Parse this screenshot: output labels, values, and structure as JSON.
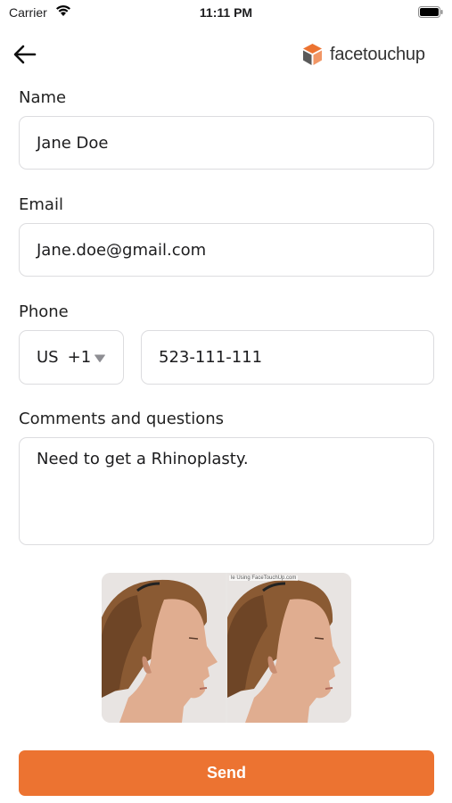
{
  "status_bar": {
    "carrier": "Carrier",
    "time": "11:11 PM"
  },
  "header": {
    "logo_text": "facetouchup",
    "logo_color": "#ec7331"
  },
  "form": {
    "name": {
      "label": "Name",
      "value": "Jane Doe"
    },
    "email": {
      "label": "Email",
      "value": "Jane.doe@gmail.com"
    },
    "phone": {
      "label": "Phone",
      "country": "US",
      "dial_code": "+1",
      "number": "523-111-111"
    },
    "comments": {
      "label": "Comments and questions",
      "value": "Need to get a Rhinoplasty."
    }
  },
  "preview": {
    "watermark": "le Using FaceTouchUp.com"
  },
  "send_label": "Send",
  "colors": {
    "accent": "#ec7331",
    "field_border": "#dcdcdf"
  }
}
